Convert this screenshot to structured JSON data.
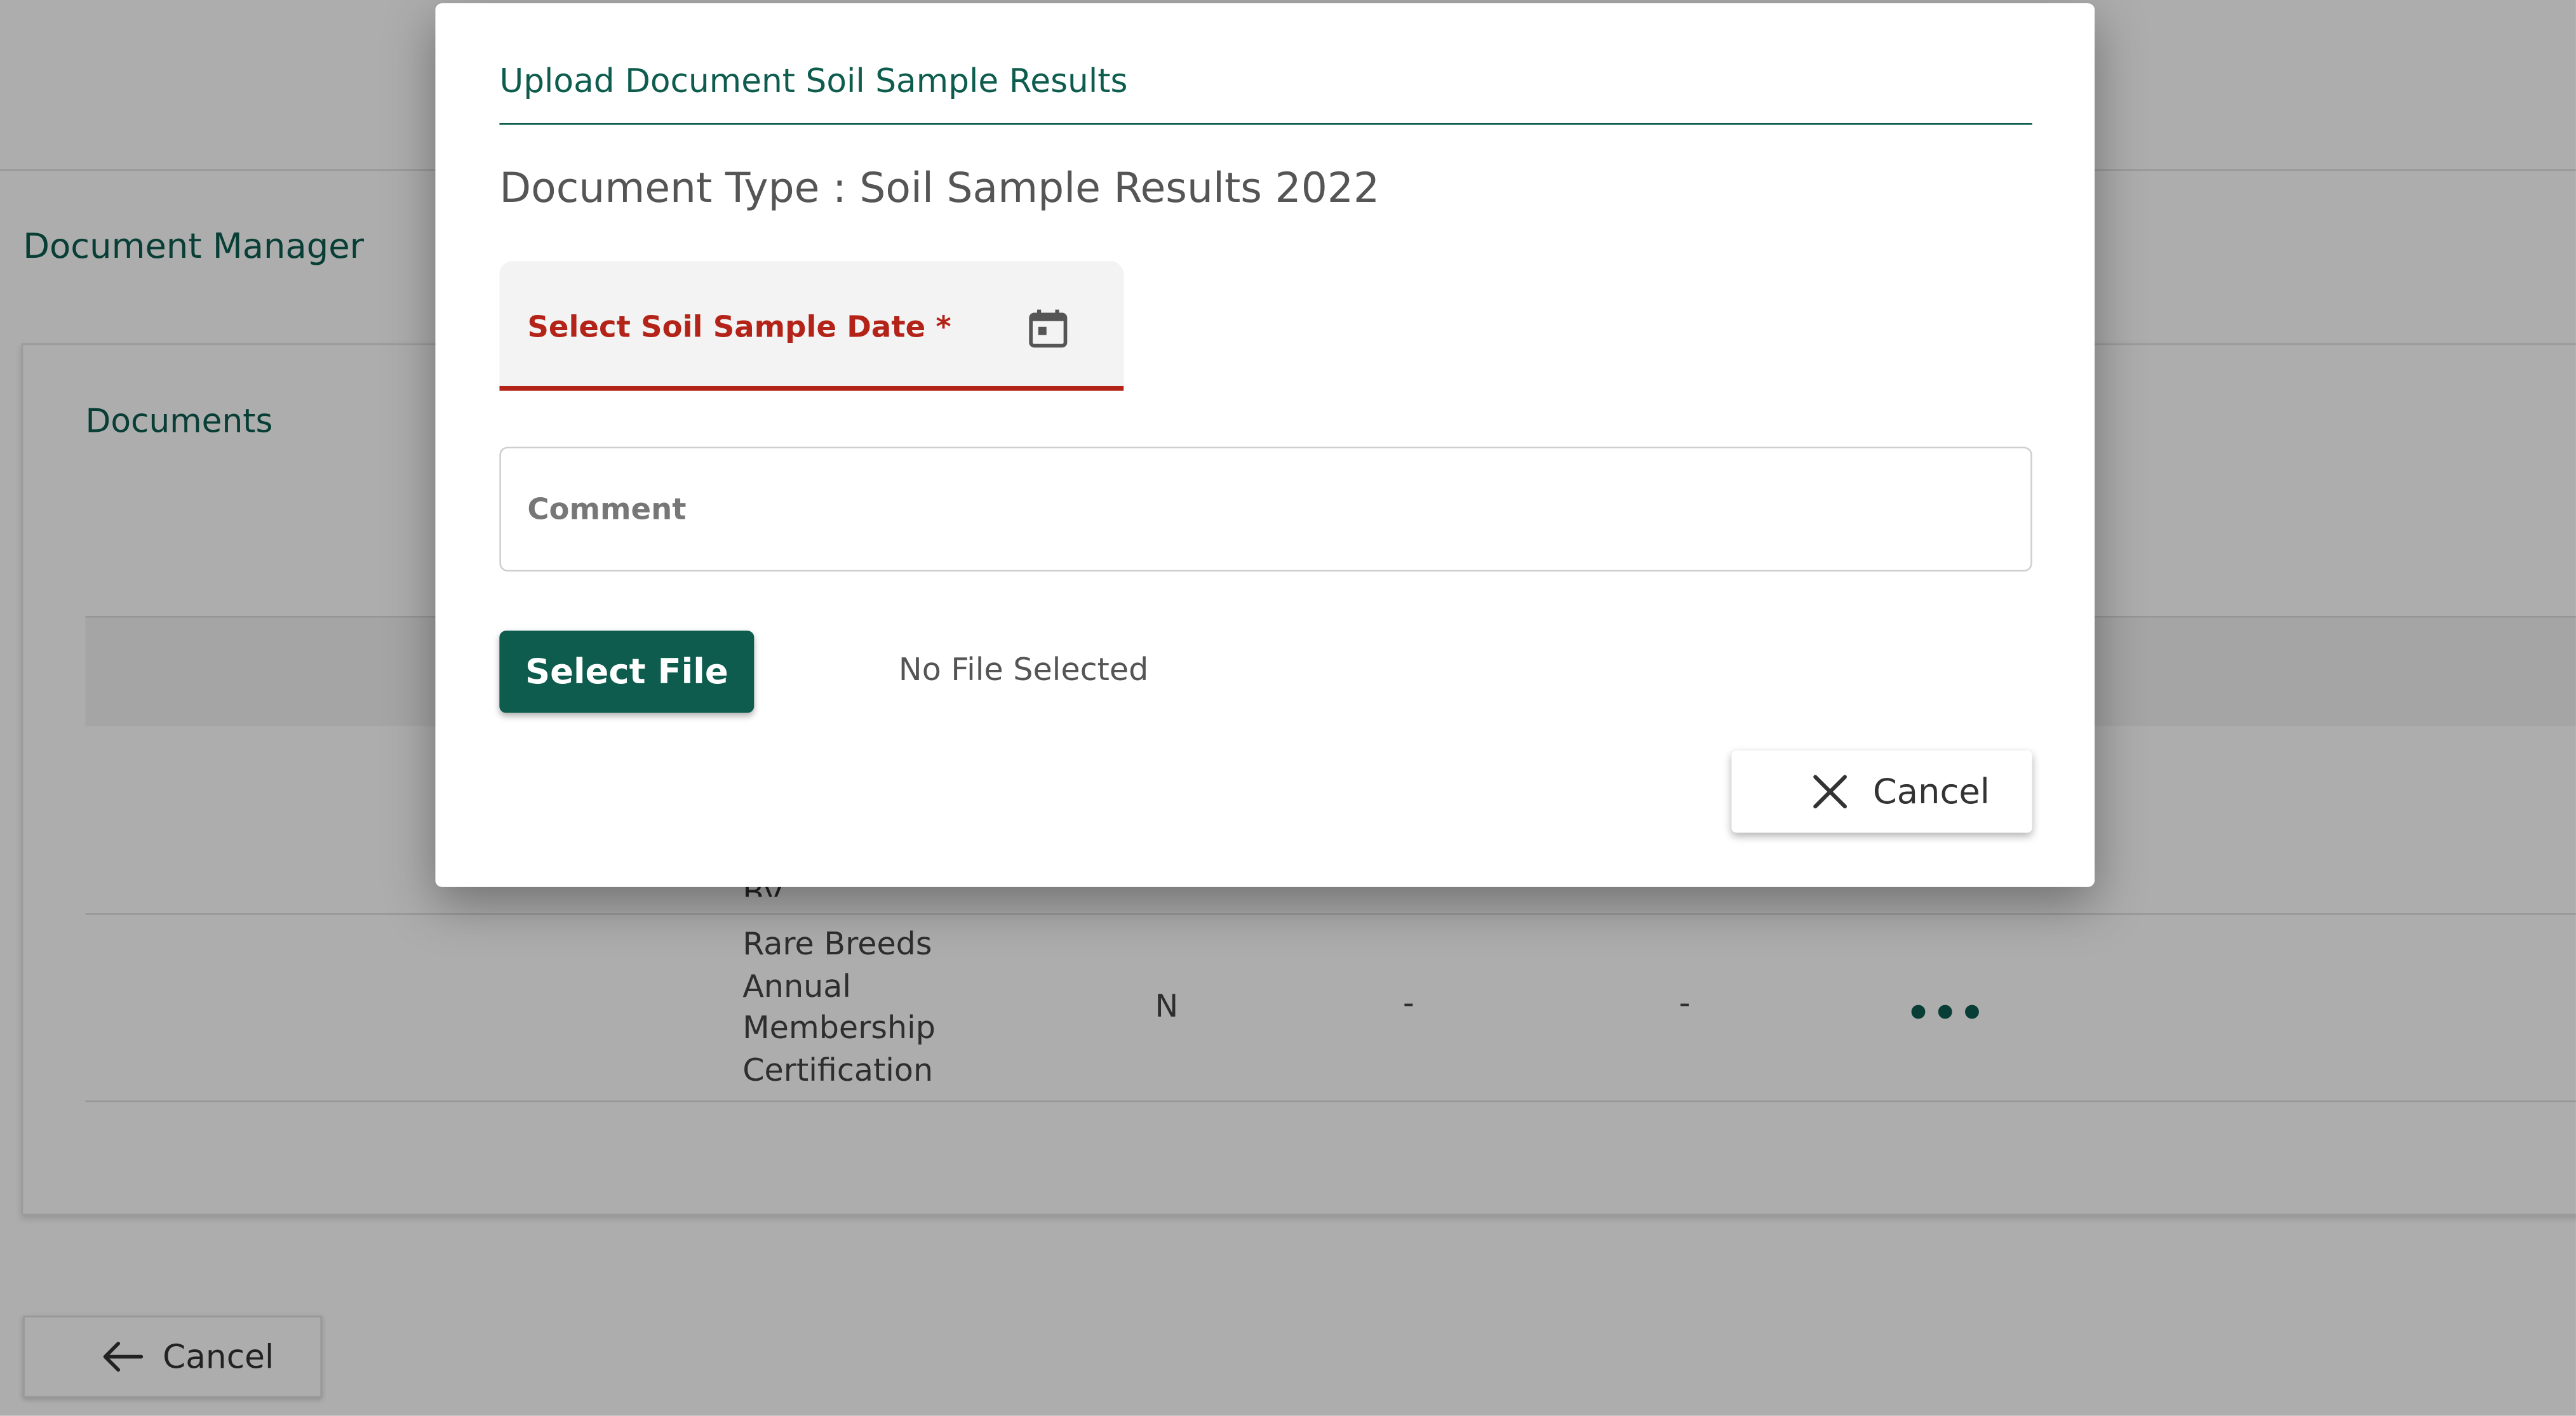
{
  "background": {
    "page_title": "Document Manager",
    "section_title": "Documents",
    "row1_partial_text": "By",
    "row2": {
      "document_name": "Rare Breeds Annual Membership Certification",
      "col_flag": "N",
      "col_a": "-",
      "col_b": "-",
      "actions_icon": "more-horizontal-icon"
    },
    "back_button_label": "Cancel",
    "back_icon": "arrow-left-icon"
  },
  "modal": {
    "title": "Upload Document Soil Sample Results",
    "document_type": "Document Type : Soil Sample Results 2022",
    "date_field": {
      "label": "Select Soil Sample Date *",
      "icon": "calendar-icon",
      "error_color": "#b42318"
    },
    "comment_field": {
      "placeholder": "Comment"
    },
    "select_file_label": "Select File",
    "file_status": "No File Selected",
    "cancel_label": "Cancel",
    "cancel_icon": "close-icon"
  },
  "colors": {
    "brand_green": "#0d5c4e",
    "error_red": "#b42318",
    "overlay": "rgba(0,0,0,0.32)"
  }
}
